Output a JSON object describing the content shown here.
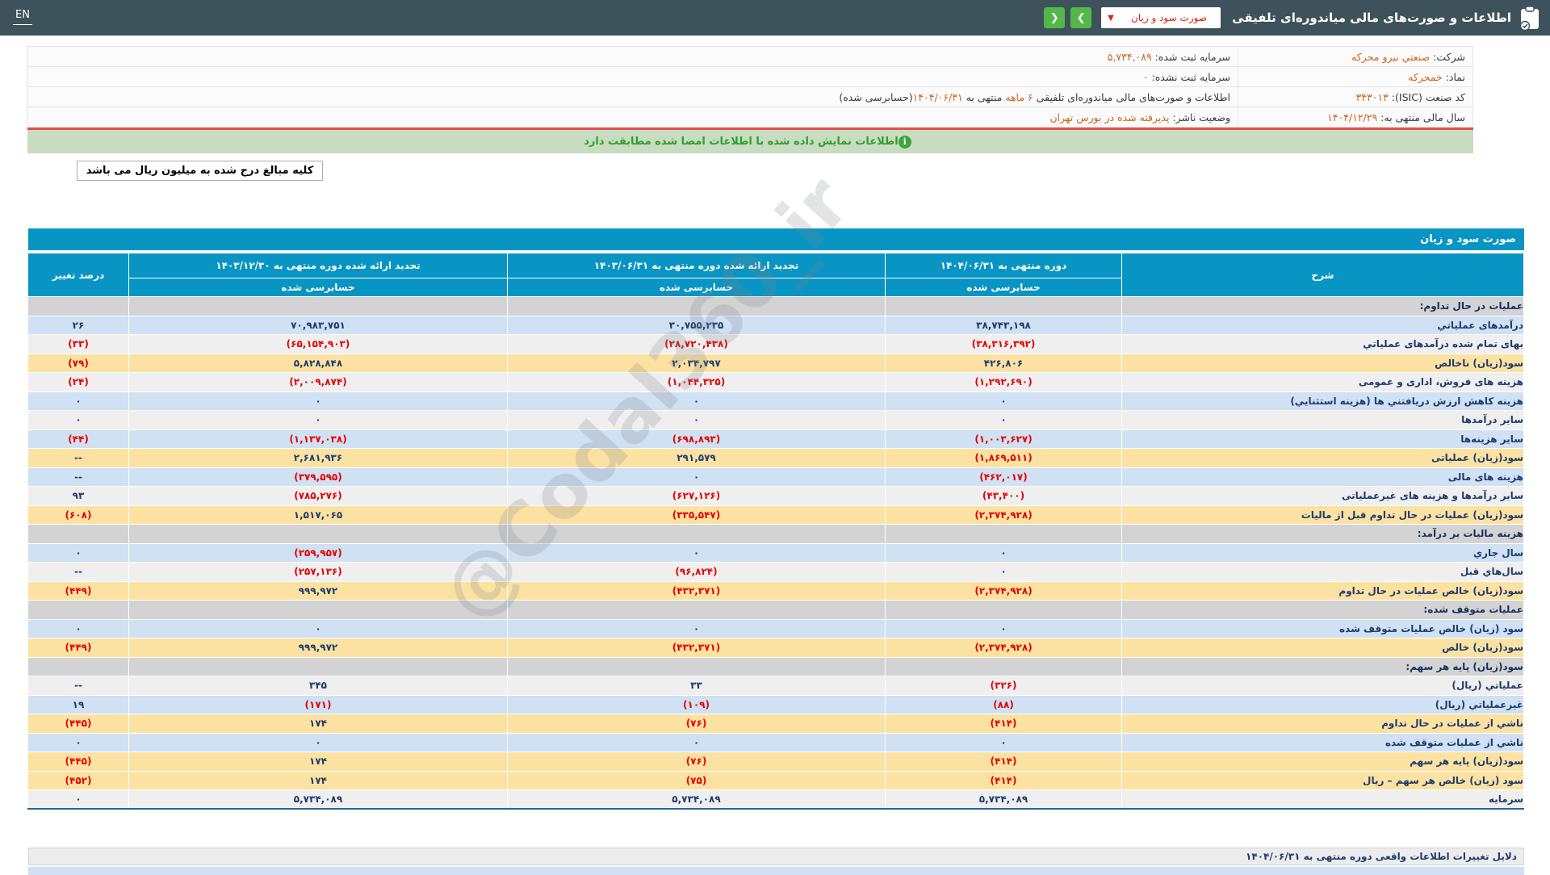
{
  "topbar": {
    "en_label": "EN",
    "title": "اطلاعات و صورت‌های مالی میاندوره‌ای تلفیقی",
    "dropdown_value": "صورت سود و زیان",
    "dropdown_chevron": "▼",
    "next_icon": "❯",
    "prev_icon": "❮"
  },
  "company_info": {
    "rows": [
      {
        "right": [
          {
            "t": "شرکت:  ",
            "c": "label"
          },
          {
            "t": "صنعتي نيرو محركه",
            "c": "accent"
          }
        ],
        "left": [
          {
            "t": "سرمایه ثبت شده:  ",
            "c": "label"
          },
          {
            "t": "۵,۷۳۴,۰۸۹",
            "c": "accent"
          }
        ]
      },
      {
        "right": [
          {
            "t": "نماد:  ",
            "c": "label"
          },
          {
            "t": "خمحركه",
            "c": "accent"
          }
        ],
        "left": [
          {
            "t": "سرمایه ثبت نشده:  ",
            "c": "label"
          },
          {
            "t": "۰",
            "c": "accent"
          }
        ]
      },
      {
        "right": [
          {
            "t": "کد صنعت (ISIC):  ",
            "c": "label"
          },
          {
            "t": "۳۴۳۰۱۳",
            "c": "accent"
          }
        ],
        "left": [
          {
            "t": "اطلاعات و صورت‌های مالی میاندوره‌ای تلفیقی ",
            "c": "label"
          },
          {
            "t": "۶ ماهه",
            "c": "accent"
          },
          {
            "t": " منتهی به ",
            "c": "label"
          },
          {
            "t": "۱۴۰۴/۰۶/۳۱",
            "c": "accent"
          },
          {
            "t": "(حسابرسی شده)",
            "c": "label"
          }
        ]
      },
      {
        "right": [
          {
            "t": "سال مالی منتهی به:  ",
            "c": "label"
          },
          {
            "t": "۱۴۰۴/۱۲/۲۹",
            "c": "accent"
          }
        ],
        "left": [
          {
            "t": "وضعیت ناشر:  ",
            "c": "label"
          },
          {
            "t": "پذيرفته شده در بورس تهران",
            "c": "accent"
          }
        ]
      }
    ]
  },
  "notice": {
    "info_icon": "i",
    "text": "اطلاعات نمایش داده شده با اطلاعات امضا شده مطابقت دارد"
  },
  "unit_note": "کلیه مبالغ درج شده به میلیون ریال می باشد",
  "watermark": "@Codal360_ir",
  "table": {
    "title": "صورت سود و زیان",
    "columns": [
      {
        "label": "شرح"
      },
      {
        "label": "دوره منتهی به ۱۴۰۴/۰۶/۳۱",
        "sub": "حسابرسی شده"
      },
      {
        "label": "تجدید ارائه شده دوره منتهی به ۱۴۰۳/۰۶/۳۱",
        "sub": "حسابرسی شده"
      },
      {
        "label": "تجدید ارائه شده دوره منتهی به ۱۴۰۳/۱۲/۳۰",
        "sub": "حسابرسی شده"
      },
      {
        "label": "درصد تغییر"
      }
    ],
    "rows": [
      {
        "type": "section",
        "label": "عملیات در حال تداوم:"
      },
      {
        "type": "data",
        "bg": "blue",
        "label": "درآمدهای عملیاتي",
        "values": [
          "۳۸,۷۴۳,۱۹۸",
          "۳۰,۷۵۵,۲۳۵",
          "۷۰,۹۸۳,۷۵۱",
          "۲۶"
        ]
      },
      {
        "type": "data",
        "bg": "gray",
        "label": "بهای تمام شده درآمدهای عملیاتي",
        "values": [
          "(۳۸,۳۱۶,۳۹۲)",
          "(۲۸,۷۲۰,۴۳۸)",
          "(۶۵,۱۵۴,۹۰۳)",
          "(۳۳)"
        ]
      },
      {
        "type": "data",
        "bg": "yellow",
        "label": "سود(زیان) ناخالص",
        "values": [
          "۴۲۶,۸۰۶",
          "۲,۰۳۴,۷۹۷",
          "۵,۸۲۸,۸۴۸",
          "(۷۹)"
        ]
      },
      {
        "type": "data",
        "bg": "gray",
        "label": "هزینه های فروش، اداری و عمومی",
        "values": [
          "(۱,۲۹۲,۶۹۰)",
          "(۱,۰۴۴,۳۲۵)",
          "(۲,۰۰۹,۸۷۴)",
          "(۲۴)"
        ]
      },
      {
        "type": "data",
        "bg": "blue",
        "label": "هزینه کاهش ارزش دریافتني ها (هزینه استثنایي)",
        "values": [
          "۰",
          "۰",
          "۰",
          "۰"
        ]
      },
      {
        "type": "data",
        "bg": "gray",
        "label": "سایر درآمدها",
        "values": [
          "۰",
          "۰",
          "۰",
          "۰"
        ]
      },
      {
        "type": "data",
        "bg": "blue",
        "label": "سایر هزینه‌ها",
        "values": [
          "(۱,۰۰۳,۶۲۷)",
          "(۶۹۸,۸۹۳)",
          "(۱,۱۳۷,۰۳۸)",
          "(۴۴)"
        ]
      },
      {
        "type": "data",
        "bg": "yellow",
        "label": "سود(زیان) عملیاتی",
        "values": [
          "(۱,۸۶۹,۵۱۱)",
          "۲۹۱,۵۷۹",
          "۲,۶۸۱,۹۳۶",
          "--"
        ]
      },
      {
        "type": "data",
        "bg": "blue",
        "label": "هزینه های مالی",
        "values": [
          "(۴۶۲,۰۱۷)",
          "۰",
          "(۳۷۹,۵۹۵)",
          "--"
        ]
      },
      {
        "type": "data",
        "bg": "gray",
        "label": "سایر درآمدها و هزینه های غیرعملیاتی",
        "values": [
          "(۴۳,۴۰۰)",
          "(۶۲۷,۱۲۶)",
          "(۷۸۵,۲۷۶)",
          "۹۳"
        ]
      },
      {
        "type": "data",
        "bg": "yellow",
        "label": "سود(زیان) عملیات در حال تداوم قبل از مالیات",
        "values": [
          "(۲,۳۷۴,۹۲۸)",
          "(۳۳۵,۵۴۷)",
          "۱,۵۱۷,۰۶۵",
          "(۶۰۸)"
        ]
      },
      {
        "type": "section",
        "label": "هزینه مالیات بر درآمد:"
      },
      {
        "type": "data",
        "bg": "blue",
        "label": "سال جاري",
        "values": [
          "۰",
          "۰",
          "(۲۵۹,۹۵۷)",
          "۰"
        ]
      },
      {
        "type": "data",
        "bg": "gray",
        "label": "سال‌هاي قبل",
        "values": [
          "۰",
          "(۹۶,۸۲۴)",
          "(۲۵۷,۱۳۶)",
          "--"
        ]
      },
      {
        "type": "data",
        "bg": "yellow",
        "label": "سود(زیان) خالص عملیات در حال تداوم",
        "values": [
          "(۲,۳۷۴,۹۲۸)",
          "(۴۳۲,۳۷۱)",
          "۹۹۹,۹۷۲",
          "(۴۴۹)"
        ]
      },
      {
        "type": "section",
        "label": "عملیات متوقف شده:"
      },
      {
        "type": "data",
        "bg": "blue",
        "label": "سود (زیان) خالص عملیات متوقف شده",
        "values": [
          "۰",
          "۰",
          "۰",
          "۰"
        ]
      },
      {
        "type": "data",
        "bg": "yellow",
        "label": "سود(زیان) خالص",
        "values": [
          "(۲,۳۷۴,۹۲۸)",
          "(۴۳۲,۳۷۱)",
          "۹۹۹,۹۷۲",
          "(۴۴۹)"
        ]
      },
      {
        "type": "section",
        "label": "سود(زیان) پایه هر سهم:"
      },
      {
        "type": "data",
        "bg": "gray",
        "label": "عملیاتي (ریال)",
        "values": [
          "(۳۲۶)",
          "۳۳",
          "۳۴۵",
          "--"
        ]
      },
      {
        "type": "data",
        "bg": "blue",
        "label": "غیرعملیاتي (ریال)",
        "values": [
          "(۸۸)",
          "(۱۰۹)",
          "(۱۷۱)",
          "۱۹"
        ]
      },
      {
        "type": "data",
        "bg": "yellow",
        "label": "ناشي از عملیات در حال تداوم",
        "values": [
          "(۴۱۴)",
          "(۷۶)",
          "۱۷۴",
          "(۴۴۵)"
        ]
      },
      {
        "type": "data",
        "bg": "blue",
        "label": "ناشي از عملیات متوقف شده",
        "values": [
          "۰",
          "۰",
          "۰",
          "۰"
        ]
      },
      {
        "type": "data",
        "bg": "yellow",
        "label": "سود(زیان) پایه هر سهم",
        "values": [
          "(۴۱۴)",
          "(۷۶)",
          "۱۷۴",
          "(۴۴۵)"
        ]
      },
      {
        "type": "data",
        "bg": "yellow",
        "label": "سود (زیان) خالص هر سهم – ریال",
        "values": [
          "(۴۱۴)",
          "(۷۵)",
          "۱۷۴",
          "(۴۵۲)"
        ]
      },
      {
        "type": "data",
        "bg": "gray",
        "label": "سرمایه",
        "values": [
          "۵,۷۳۴,۰۸۹",
          "۵,۷۳۴,۰۸۹",
          "۵,۷۳۴,۰۸۹",
          "۰"
        ]
      }
    ]
  },
  "footer_section": {
    "title": "دلایل تغییرات اطلاعات واقعی دوره منتهی به ۱۴۰۴/۰۶/۳۱"
  },
  "colors": {
    "topbar": "#3d525a",
    "accent_teal": "#0995c3",
    "button_green": "#53b849",
    "dropdown_red": "#d9261c",
    "value_orange": "#c9661f",
    "notice_green": "#2f9e2f",
    "row_blue": "#cfe1f3",
    "row_gray": "#efefef",
    "row_yellow": "#fce2a2",
    "row_section": "#d3d3d3",
    "value_navy": "#1f3b6e",
    "value_negative": "#e60000",
    "divider_red": "#e25050"
  }
}
